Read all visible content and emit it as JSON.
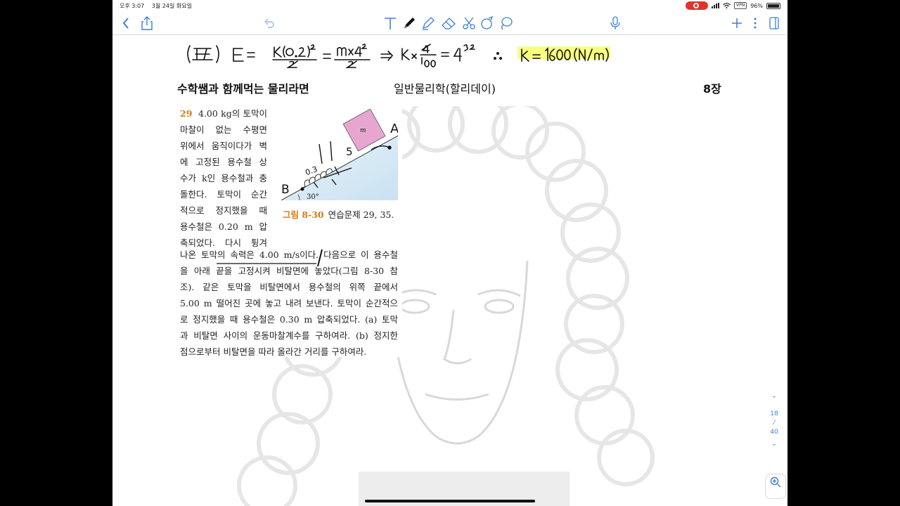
{
  "status": {
    "time": "오후 3:07",
    "date": "3월 24일 화요일",
    "vpn": "VPN",
    "battery": "96%"
  },
  "toolbar": {
    "icons": [
      "back-icon",
      "share-icon",
      "undo-icon",
      "text-tool-icon",
      "pen-icon",
      "highlighter-icon",
      "eraser-icon",
      "scissors-icon",
      "shape-icon",
      "lasso-icon",
      "microphone-icon",
      "add-icon",
      "more-icon",
      "page-layout-icon"
    ]
  },
  "handwriting": "(풀이) E = k(0.2)²/2 = m×4²/2 ⇒ k × 4/100 = 4³² ∴ k = 1600 (N/m)",
  "header": {
    "left": "수학쌤과 함께먹는 물리라면",
    "center": "일반물리학(할리데이)",
    "right": "8장"
  },
  "problem": {
    "number": "29",
    "lines_narrow": [
      "4.00 kg의 토막이",
      "마찰이 없는 수평면",
      "위에서 움직이다가 벽",
      "에 고정된 용수철 상",
      "수가 k인 용수철과 충",
      "돌한다. 토막이 순간",
      "적으로 정지했을 때",
      "용수철은 0.20 m 압",
      "축되었다. 다시 튕겨"
    ],
    "lines_wide": [
      "나온 토막의 속력은 4.00 m/s이다. 다음으로 이 용수철",
      "을 아래 끝을 고정시켜 비탈면에 놓았다(그림 8-30 참",
      "조). 같은 토막을 비탈면에서 용수철의 위쪽 끝에서",
      "5.00 m 떨어진 곳에 놓고 내려 보낸다. 토막이 순간적으",
      "로 정지했을 때 용수철은 0.30 m 압축되었다. (a) 토막",
      "과 비탈면 사이의 운동마찰계수를 구하여라. (b) 정지한",
      "점으로부터 비탈면을 따라 올라간 거리를 구하여라."
    ]
  },
  "figure": {
    "caption_label": "그림 8-30",
    "caption_text": "연습문제 29, 35.",
    "block_label": "m",
    "angle": "30°",
    "mark_a": "A",
    "mark_b": "B",
    "mark_5": "5",
    "mark_03": "0.3"
  },
  "navigator": {
    "current_page": "18",
    "total_pages": "40"
  }
}
